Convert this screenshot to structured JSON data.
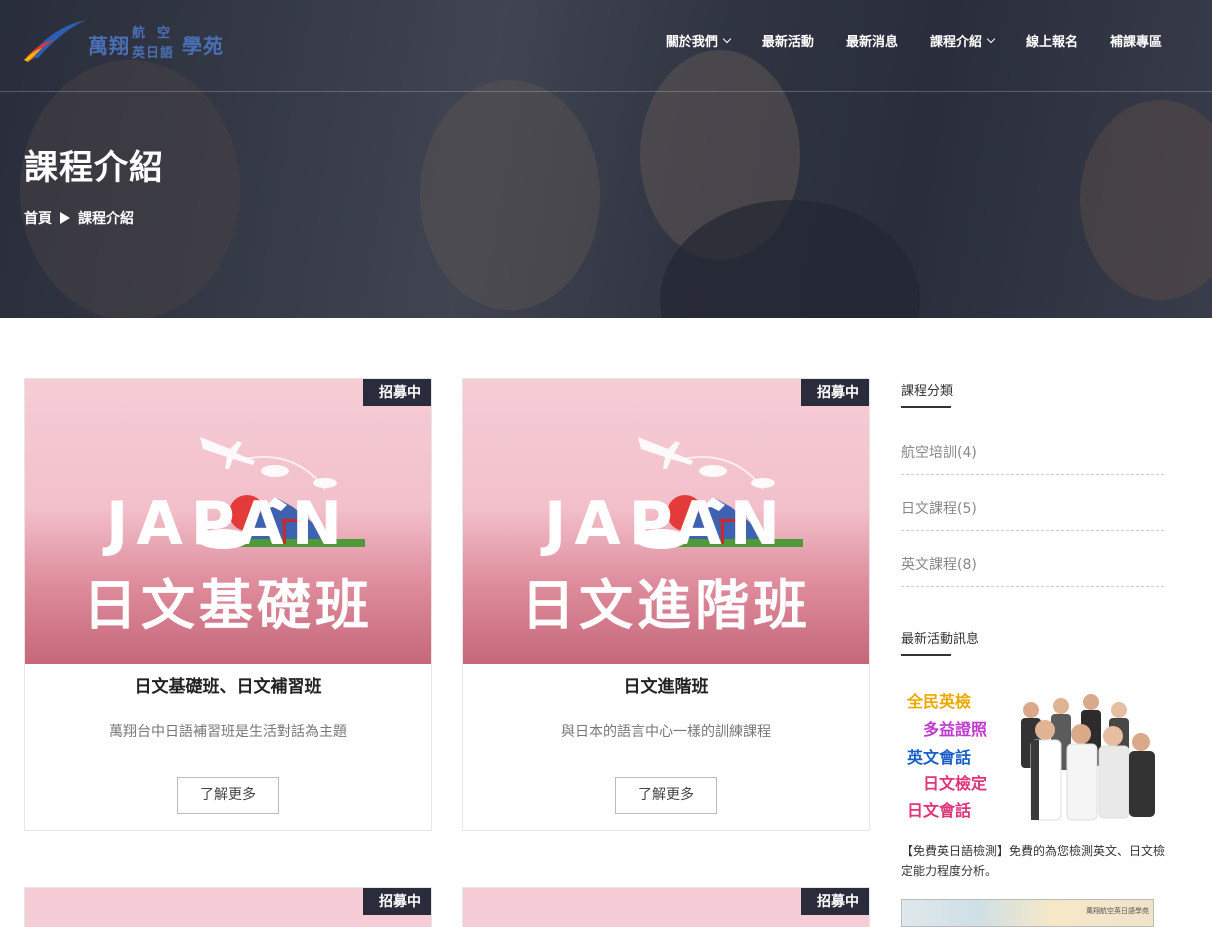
{
  "header": {
    "logo": {
      "main": "萬翔",
      "top": "航空",
      "bottom": "英日語",
      "side": "學苑"
    },
    "nav": [
      {
        "label": "關於我們",
        "has_dropdown": true
      },
      {
        "label": "最新活動",
        "has_dropdown": false
      },
      {
        "label": "最新消息",
        "has_dropdown": false
      },
      {
        "label": "課程介紹",
        "has_dropdown": true
      },
      {
        "label": "線上報名",
        "has_dropdown": false
      },
      {
        "label": "補課專區",
        "has_dropdown": false
      }
    ]
  },
  "hero": {
    "title": "課程介紹",
    "breadcrumb": [
      "首頁",
      "課程介紹"
    ]
  },
  "courses": [
    {
      "badge": "招募中",
      "image_word": "JAPAN",
      "image_title": "日文基礎班",
      "title": "日文基礎班、日文補習班",
      "desc": "萬翔台中日語補習班是生活對話為主題",
      "button": "了解更多"
    },
    {
      "badge": "招募中",
      "image_word": "JAPAN",
      "image_title": "日文進階班",
      "title": "日文進階班",
      "desc": "與日本的語言中心一樣的訓練課程",
      "button": "了解更多"
    },
    {
      "badge": "招募中"
    },
    {
      "badge": "招募中"
    }
  ],
  "sidebar": {
    "category_heading": "課程分類",
    "categories": [
      "航空培訓(4)",
      "日文課程(5)",
      "英文課程(8)"
    ],
    "news_heading": "最新活動訊息",
    "promo_lines": [
      "全民英檢",
      "多益證照",
      "英文會話",
      "日文檢定",
      "日文會話"
    ],
    "promo_caption": "【免費英日語檢測】免費的為您檢測英文、日文檢定能力程度分析。",
    "promo2_label": "萬翔航空英日語學苑"
  },
  "colors": {
    "badge_bg": "#2a2c3b",
    "logo_blue": "#4a6fb5",
    "thumb_pink": "#f2c0cb",
    "promo_colors": [
      "#f0a800",
      "#c03ad0",
      "#1a5fc8",
      "#e0337a",
      "#e0337a"
    ]
  }
}
